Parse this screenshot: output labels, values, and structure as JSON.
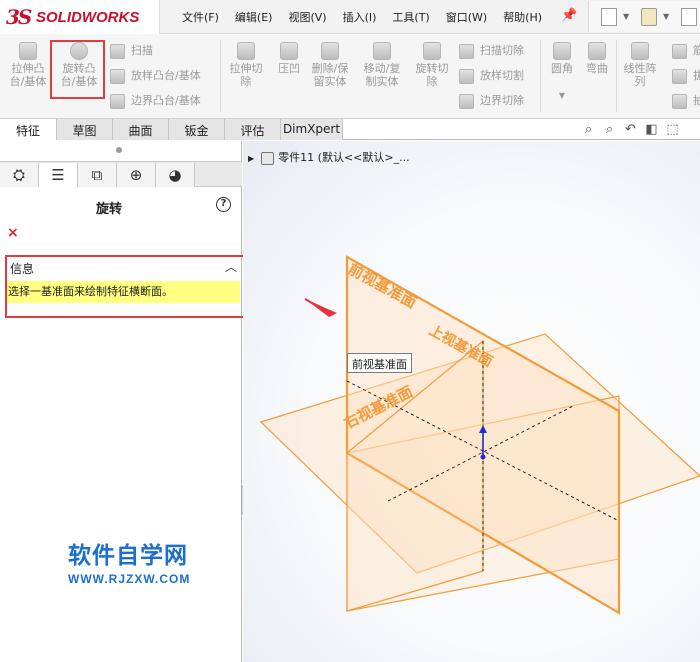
{
  "app": {
    "logo_ds": "3S",
    "logo_brand": "SOLIDWORKS"
  },
  "menu": [
    "文件(F)",
    "编辑(E)",
    "视图(V)",
    "插入(I)",
    "工具(T)",
    "窗口(W)",
    "帮助(H)"
  ],
  "ribbon": {
    "extrude_boss": "拉伸凸\n台/基体",
    "revolve_boss": "旋转凸\n台/基体",
    "sweep": "扫描",
    "loft_boss": "放样凸台/基体",
    "boundary_boss": "边界凸台/基体",
    "extrude_cut": "拉伸切\n除",
    "indent": "压凹",
    "delete_keep_body": "删除/保\n留实体",
    "move_copy_body": "移动/复\n制实体",
    "revolve_cut": "旋转切\n除",
    "sweep_cut": "扫描切除",
    "loft_cut": "放样切割",
    "boundary_cut": "边界切除",
    "fillet": "圆角",
    "wrap": "弯曲",
    "linear_pattern": "线性阵\n列",
    "rib_partial": "筋",
    "draft_partial": "拔",
    "shell_partial": "抽"
  },
  "tabs": [
    "特征",
    "草图",
    "曲面",
    "钣金",
    "评估",
    "DimXpert"
  ],
  "feature_tree": {
    "part_label": "零件11  (默认<<默认>_..."
  },
  "property_manager": {
    "title": "旋转",
    "help": "?",
    "cancel": "×",
    "info_header": "信息",
    "info_message": "选择一基准面来绘制特征横断面。"
  },
  "planes": {
    "front": "前视基准面",
    "top": "上视基准面",
    "right": "右视基准面",
    "plane_color": "#f39a3a",
    "fill_color": "#fde2c4"
  },
  "tooltip": "前视基准面",
  "watermark": {
    "cn": "软件自学网",
    "url": "WWW.RJZXW.COM"
  }
}
